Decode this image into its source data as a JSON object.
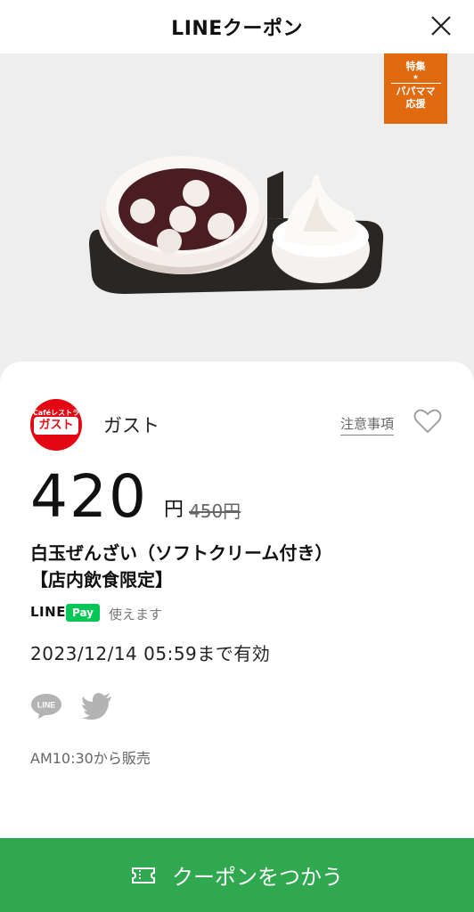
{
  "header": {
    "title": "LINEクーポン"
  },
  "hero": {
    "ribbon": {
      "top": "特集",
      "star": "★",
      "line1": "パパママ",
      "line2": "応援"
    }
  },
  "brand": {
    "logo_small": "Caféレストラン",
    "logo_big": "ガスト",
    "name": "ガスト",
    "notice_link": "注意事項"
  },
  "price": {
    "amount": "420",
    "yen": "円",
    "original": "450円"
  },
  "item": {
    "title_line1": "白玉ぜんざい（ソフトクリーム付き）",
    "title_line2": "【店内飲食限定】"
  },
  "pay": {
    "line_label": "LINE",
    "pay_label": "Pay",
    "availability": "使えます"
  },
  "valid_until": "2023/12/14  05:59まで有効",
  "sale_start": "AM10:30から販売",
  "cta": {
    "label": "クーポンをつかう"
  },
  "colors": {
    "accent": "#30a84f",
    "ribbon": "#e06a10",
    "brand_red": "#e30613",
    "line_green": "#06c755"
  }
}
